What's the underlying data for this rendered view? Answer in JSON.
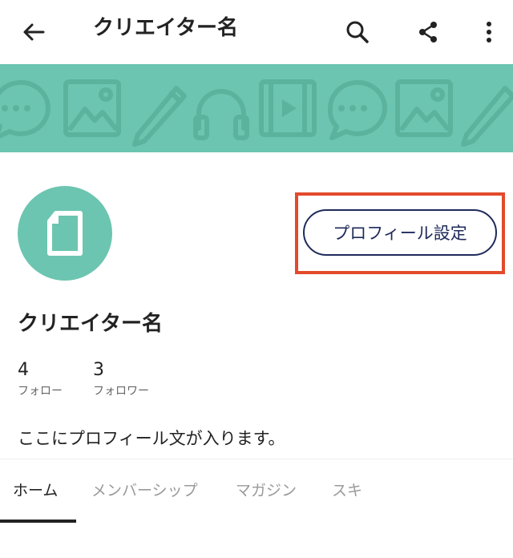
{
  "app_bar": {
    "title": "クリエイター名",
    "icons": {
      "back": "arrow-left-icon",
      "search": "search-icon",
      "share": "share-icon",
      "more": "more-vertical-icon"
    }
  },
  "banner": {
    "background_color": "#6cc5b0",
    "pattern_icons": [
      "chat-bubble-icon",
      "image-icon",
      "pencil-icon",
      "headphones-icon",
      "film-icon",
      "chat-bubble-icon",
      "image-icon",
      "pencil-icon"
    ]
  },
  "profile": {
    "avatar_icon": "note-document-icon",
    "avatar_color": "#6cc5b0",
    "settings_button_label": "プロフィール設定",
    "highlight_color": "#e24a2b",
    "name": "クリエイター名",
    "stats": {
      "follow_count": "4",
      "follow_label": "フォロー",
      "follower_count": "3",
      "follower_label": "フォロワー"
    },
    "bio": "ここにプロフィール文が入ります。"
  },
  "tabs": {
    "items": [
      {
        "label": "ホーム",
        "active": true
      },
      {
        "label": "メンバーシップ",
        "active": false
      },
      {
        "label": "マガジン",
        "active": false
      },
      {
        "label": "スキ",
        "active": false
      }
    ]
  }
}
